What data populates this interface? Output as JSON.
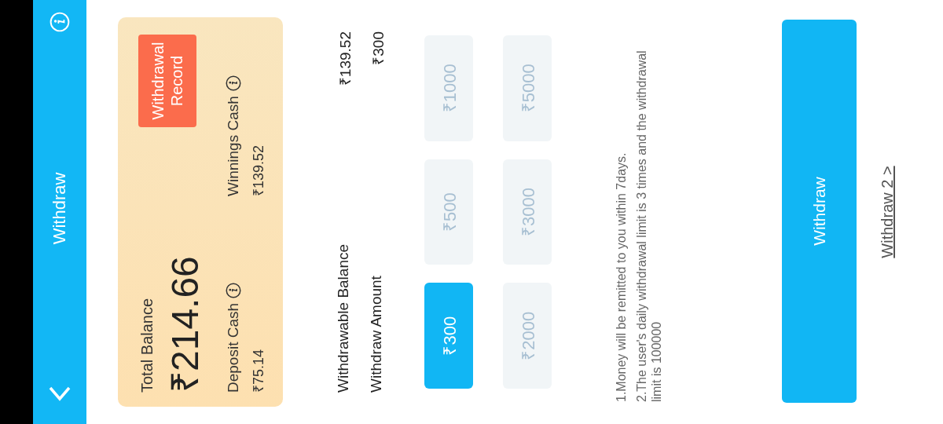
{
  "header": {
    "title": "Withdraw"
  },
  "balance_card": {
    "total_label": "Total Balance",
    "total_amount": "₹214.66",
    "record_button": "Withdrawal Record",
    "deposit": {
      "label": "Deposit Cash",
      "amount": "₹75.14"
    },
    "winnings": {
      "label": "Winnings Cash",
      "amount": "₹139.52"
    }
  },
  "summary": [
    {
      "label": "Withdrawable Balance",
      "value": "₹139.52"
    },
    {
      "label": "Withdraw Amount",
      "value": "₹300"
    }
  ],
  "amount_options": [
    {
      "label": "₹300",
      "selected": true
    },
    {
      "label": "₹500",
      "selected": false
    },
    {
      "label": "₹1000",
      "selected": false
    },
    {
      "label": "₹2000",
      "selected": false
    },
    {
      "label": "₹3000",
      "selected": false
    },
    {
      "label": "₹5000",
      "selected": false
    }
  ],
  "notes": [
    "1.Money will be remitted to you within 7days.",
    "2.The user's daily withdrawal limit is 3 times and the withdrawal limit is 100000"
  ],
  "withdraw_button": "Withdraw",
  "alt_link": "Withdraw 2 >"
}
